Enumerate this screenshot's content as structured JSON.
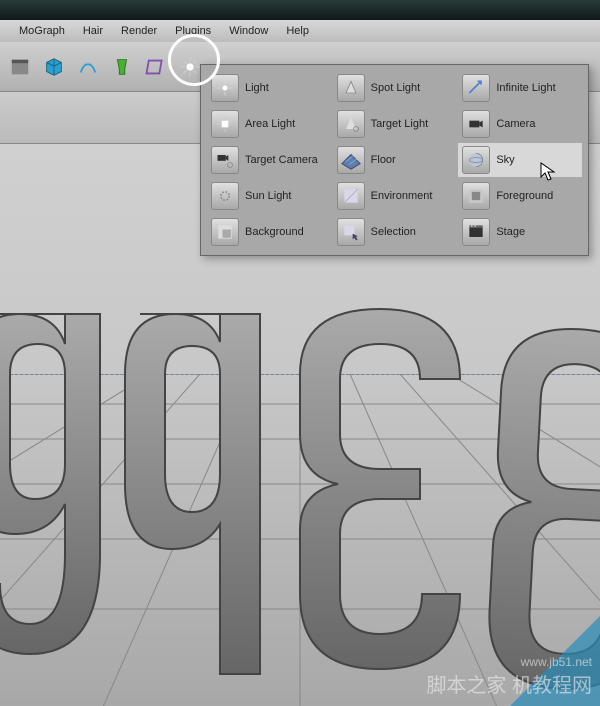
{
  "menus": [
    "MoGraph",
    "Hair",
    "Render",
    "Plugins",
    "Window",
    "Help"
  ],
  "popup_rows": [
    [
      "Light",
      "Spot Light",
      "Infinite Light"
    ],
    [
      "Area Light",
      "Target Light",
      "Camera"
    ],
    [
      "Target Camera",
      "Floor",
      "Sky"
    ],
    [
      "Sun Light",
      "Environment",
      "Foreground"
    ],
    [
      "Background",
      "Selection",
      "Stage"
    ]
  ],
  "watermark": {
    "big": "脚本之家",
    "site": "机教程网",
    "url": "www.jb51.net"
  },
  "colors": {
    "cube": "#2aa0d0",
    "glass": "#4ab030",
    "hover": "#d8d8d8"
  }
}
